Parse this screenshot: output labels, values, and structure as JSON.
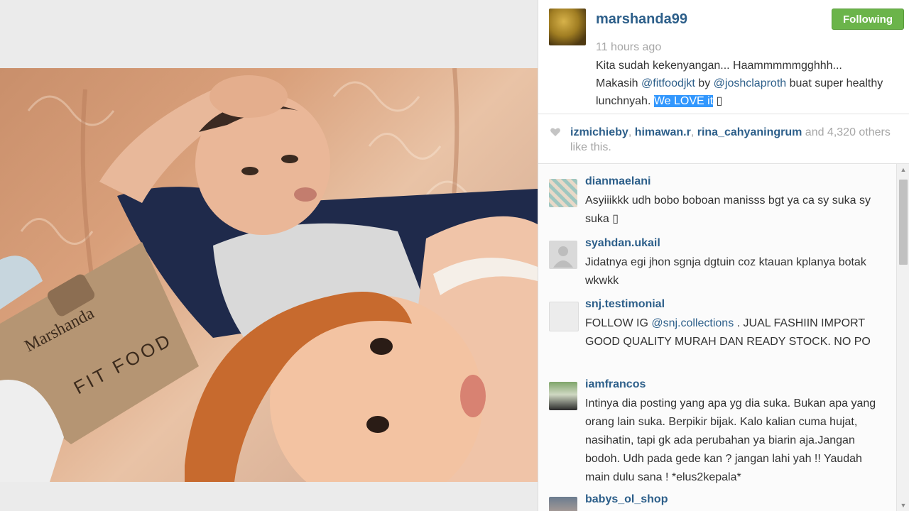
{
  "post": {
    "username": "marshanda99",
    "time": "11 hours ago",
    "follow_label": "Following",
    "caption": {
      "line1": "Kita sudah kekenyangan... Haammmmmgghhh...",
      "pre": "Makasih ",
      "mention1": "@fitfoodjkt",
      "mid": " by ",
      "mention2": "@joshclaproth",
      "post": " buat super healthy lunchnyah. ",
      "selected": "We LOVE it",
      "emoji": " ▯"
    }
  },
  "likes": {
    "liker1": "izmichieby",
    "sep1": ", ",
    "liker2": "himawan.r",
    "sep2": ", ",
    "liker3": "rina_cahyaningrum",
    "rest": " and 4,320 others like this."
  },
  "comments": [
    {
      "user": "dianmaelani",
      "text": "Asyiiikkk udh bobo boboan manisss bgt ya ca sy suka sy suka ▯"
    },
    {
      "user": "syahdan.ukail",
      "text": "Jidatnya egi jhon sgnja dgtuin coz ktauan kplanya botak wkwkk"
    },
    {
      "user": "snj.testimonial",
      "text_pre": "FOLLOW IG ",
      "mention": "@snj.collections",
      "text_post": " . JUAL FASHIIN IMPORT GOOD QUALITY MURAH DAN READY STOCK. NO PO"
    },
    {
      "user": "iamfrancos",
      "text": "Intinya dia posting yang apa yg dia suka. Bukan apa yang orang lain suka. Berpikir bijak. Kalo kalian cuma hujat, nasihatin, tapi gk ada perubahan ya biarin aja.Jangan bodoh. Udh pada gede kan ? jangan lahi yah !! Yaudah main dulu sana ! *elus2kepala*"
    },
    {
      "user": "babys_ol_shop",
      "text": ""
    }
  ],
  "photo": {
    "bag_brand": "Marshanda",
    "bag_label": "FIT FOOD"
  },
  "colors": {
    "accent": "#2d5f8a",
    "follow_green": "#6bb44a",
    "muted": "#a6a6a6",
    "selection": "#3297fd"
  },
  "icons": {
    "like": "heart-icon",
    "scroll_up": "arrow-up-icon",
    "scroll_down": "arrow-down-icon"
  }
}
